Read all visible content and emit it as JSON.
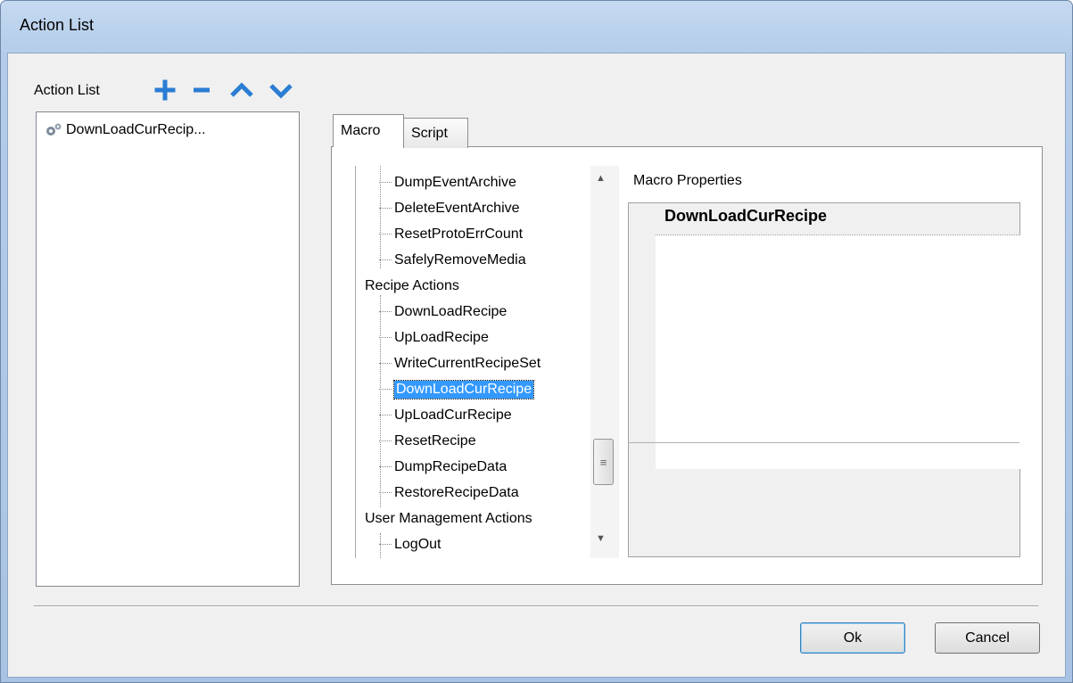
{
  "window": {
    "title": "Action List"
  },
  "toolbar": {
    "label": "Action List",
    "icons": [
      "plus-icon",
      "minus-icon",
      "chevron-up-icon",
      "chevron-down-icon"
    ],
    "accent": "#2b7cd3"
  },
  "action_list": {
    "items": [
      {
        "label": "DownLoadCurRecip..."
      }
    ]
  },
  "tabs": [
    {
      "label": "Macro",
      "active": true
    },
    {
      "label": "Script",
      "active": false
    }
  ],
  "tree": {
    "rows": [
      {
        "label": "DumpEventArchive",
        "kind": "child"
      },
      {
        "label": "DeleteEventArchive",
        "kind": "child"
      },
      {
        "label": "ResetProtoErrCount",
        "kind": "child"
      },
      {
        "label": "SafelyRemoveMedia",
        "kind": "child"
      },
      {
        "label": "Recipe Actions",
        "kind": "group"
      },
      {
        "label": "DownLoadRecipe",
        "kind": "child"
      },
      {
        "label": "UpLoadRecipe",
        "kind": "child"
      },
      {
        "label": "WriteCurrentRecipeSet",
        "kind": "child"
      },
      {
        "label": "DownLoadCurRecipe",
        "kind": "child",
        "selected": true
      },
      {
        "label": "UpLoadCurRecipe",
        "kind": "child"
      },
      {
        "label": "ResetRecipe",
        "kind": "child"
      },
      {
        "label": "DumpRecipeData",
        "kind": "child"
      },
      {
        "label": "RestoreRecipeData",
        "kind": "child"
      },
      {
        "label": "User Management Actions",
        "kind": "group"
      },
      {
        "label": "LogOut",
        "kind": "child"
      }
    ]
  },
  "macro_properties": {
    "label": "Macro Properties",
    "title": "DownLoadCurRecipe"
  },
  "footer": {
    "ok_label": "Ok",
    "cancel_label": "Cancel"
  }
}
